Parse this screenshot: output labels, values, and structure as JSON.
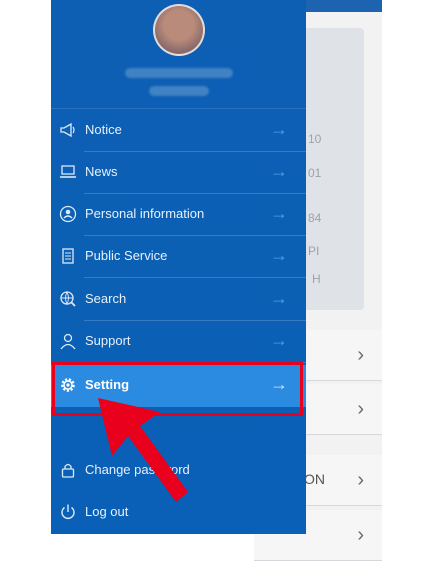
{
  "drawer": {
    "menu": [
      {
        "label": "Notice",
        "icon": "megaphone-icon"
      },
      {
        "label": "News",
        "icon": "laptop-icon"
      },
      {
        "label": "Personal information",
        "icon": "id-badge-icon"
      },
      {
        "label": "Public Service",
        "icon": "document-icon"
      },
      {
        "label": "Search",
        "icon": "globe-search-icon"
      },
      {
        "label": "Support",
        "icon": "person-icon"
      },
      {
        "label": "Setting",
        "icon": "gear-icon",
        "selected": true
      },
      {
        "label": "Change password",
        "icon": "lock-icon"
      },
      {
        "label": "Log out",
        "icon": "power-icon"
      }
    ],
    "arrow_glyph": "→"
  },
  "background": {
    "fragments": [
      "10",
      "01",
      "84",
      "PI",
      "H",
      "ON"
    ],
    "chevron_glyph": "›"
  },
  "colors": {
    "drawer_bg": "#0c5fb3",
    "selected_bg": "#2b8be0",
    "highlight": "#e8001c"
  }
}
